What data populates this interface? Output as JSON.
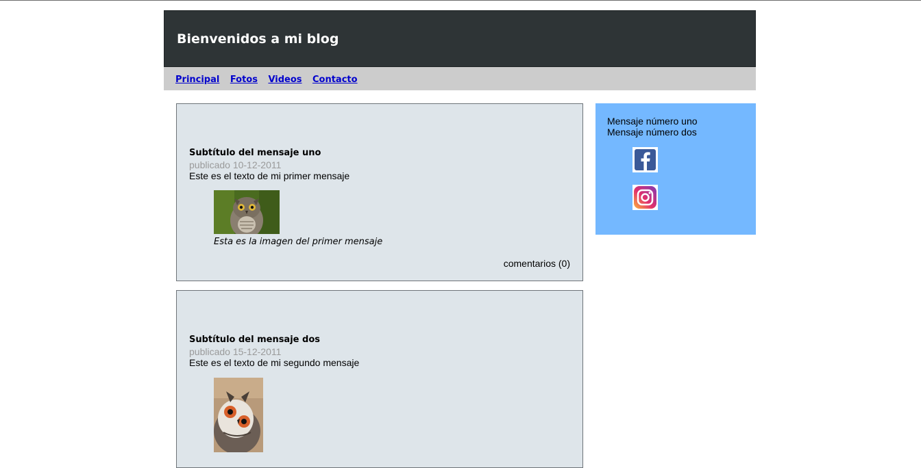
{
  "header": {
    "title": "Bienvenidos a mi blog"
  },
  "nav": {
    "items": [
      "Principal",
      "Fotos",
      "Videos",
      "Contacto"
    ]
  },
  "posts": [
    {
      "subtitle": "Subtítulo del mensaje uno",
      "date": "publicado 10-12-2011",
      "text": "Este es el texto de mi primer mensaje",
      "image": "owl-photo",
      "caption": "Esta es la imagen del primer mensaje",
      "comments": "comentarios (0)"
    },
    {
      "subtitle": "Subtítulo del mensaje dos",
      "date": "publicado 15-12-2011",
      "text": "Este es el texto de mi segundo mensaje",
      "image": "owl-photo"
    }
  ],
  "sidebar": {
    "messages": [
      "Mensaje número uno",
      "Mensaje número dos"
    ],
    "social": [
      "facebook-icon",
      "instagram-icon"
    ]
  },
  "colors": {
    "header_bg": "#2e3436",
    "nav_bg": "#cccccc",
    "link": "#0000cc",
    "post_bg": "#dee5ea",
    "sidebar_bg": "#74b8ff",
    "date": "#9a9a9a"
  }
}
